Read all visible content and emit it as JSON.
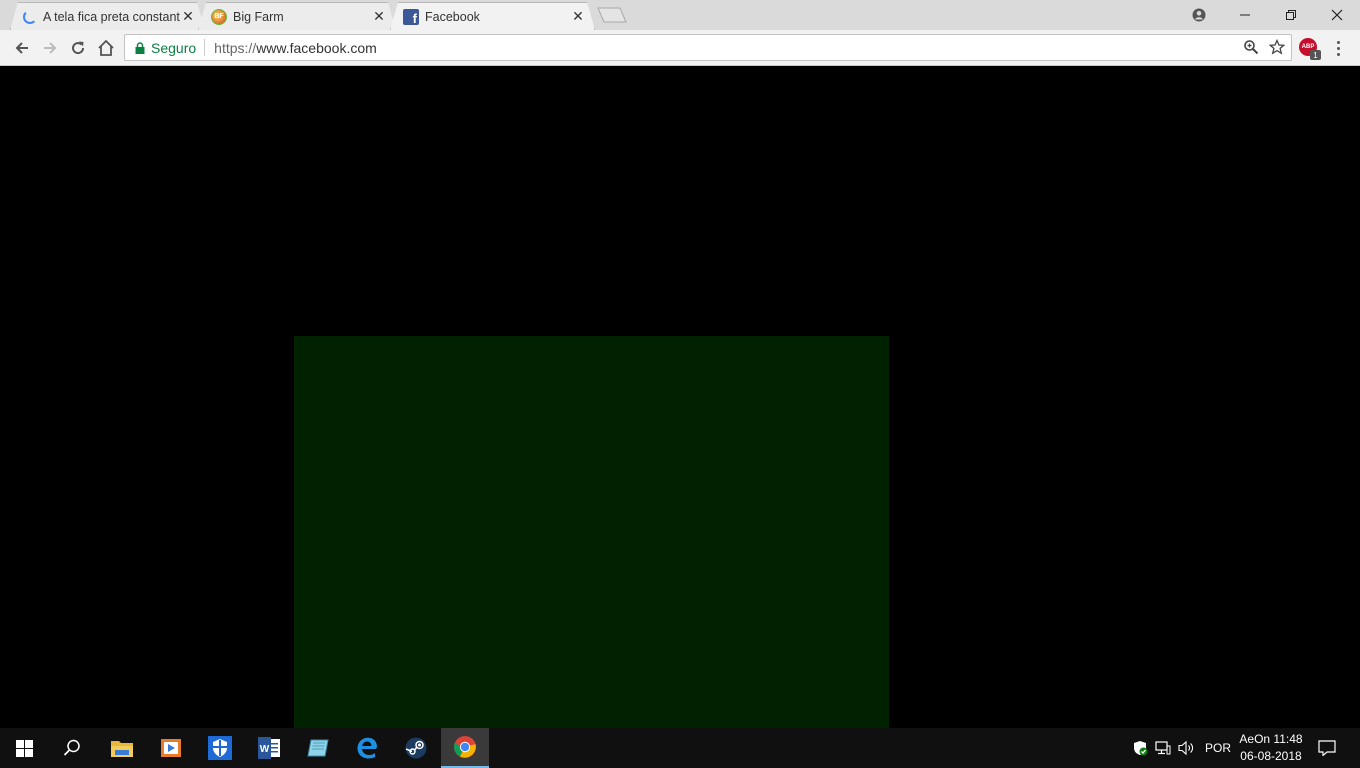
{
  "browser": {
    "tabs": [
      {
        "title": "A tela fica preta constant",
        "icon": "loading-spinner-icon",
        "active": false
      },
      {
        "title": "Big Farm",
        "icon": "big-farm-icon",
        "active": false
      },
      {
        "title": "Facebook",
        "icon": "facebook-icon",
        "active": true
      }
    ],
    "close_glyph": "✕",
    "omnibox": {
      "security_label": "Seguro",
      "url_scheme": "https://",
      "url_host": "www.facebook.com"
    },
    "extensions": {
      "adblock_label": "ABP",
      "adblock_count": "1"
    }
  },
  "content": {
    "background": "#000000",
    "box_color": "#002200"
  },
  "taskbar": {
    "apps": [
      "windows-start",
      "search",
      "file-explorer",
      "media-player",
      "windows-defender",
      "word",
      "notepad",
      "edge",
      "steam",
      "chrome"
    ],
    "active_app": "chrome",
    "tray": {
      "language": "POR",
      "time": "AeOn 11:48",
      "date": "06-08-2018"
    }
  }
}
